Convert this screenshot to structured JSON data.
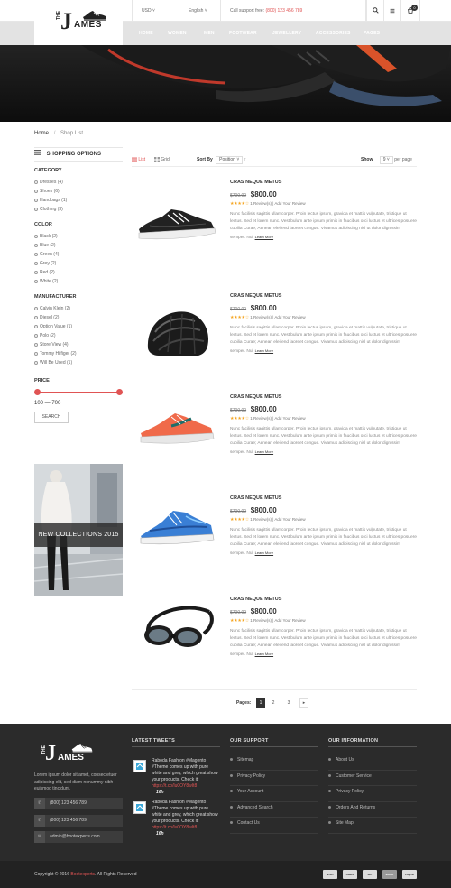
{
  "header": {
    "currency": "USD",
    "language": "English",
    "support_label": "Call support free:",
    "support_phone": "(800) 123 456 789",
    "cart_count": "0",
    "logo_the": "THE",
    "logo_j": "J",
    "logo_ames": "AMES",
    "nav": [
      "HOME",
      "WOMEN",
      "MEN",
      "FOOTWEAR",
      "JEWELLERY",
      "ACCESSORIES",
      "PAGES"
    ]
  },
  "breadcrumb": {
    "home": "Home",
    "separator": "/",
    "current": "Shop List"
  },
  "sidebar": {
    "title": "SHOPPING OPTIONS",
    "category_title": "CATEGORY",
    "categories": [
      "Dresses (4)",
      "Shoes (6)",
      "Handbags (1)",
      "Clothing (3)"
    ],
    "color_title": "COLOR",
    "colors": [
      "Black (2)",
      "Blue (2)",
      "Green (4)",
      "Grey (2)",
      "Red (2)",
      "White (2)"
    ],
    "manufacturer_title": "MANUFACTURER",
    "manufacturers": [
      "Calvin Klein (2)",
      "Diesel (2)",
      "Option Value (1)",
      "Polo (2)",
      "Store View (4)",
      "Tommy Hilfiger (2)",
      "Will Be Used (1)"
    ],
    "price_title": "PRICE",
    "price_range": "100 — 700",
    "search_label": "SEARCH",
    "promo_label": "NEW COLLECTIONS 2015"
  },
  "toolbar": {
    "list_label": "List",
    "grid_label": "Grid",
    "sort_label": "Sort By",
    "sort_value": "Position",
    "show_label": "Show",
    "show_value": "9",
    "per_page_label": "per page"
  },
  "products": [
    {
      "name": "CRAS NEQUE METUS",
      "old_price": "$700.00",
      "price": "$800.00",
      "stars": "★★★★☆",
      "reviews": "1 Review(s) | Add Your Review",
      "desc": "Nunc facilisis sagittis ullamcorper. Proin lectus ipsum, gravida et mattis vulputate, tristique ut lectus. Sed et lorem nunc. Vestibulum ante ipsum primis in faucibus orci luctus et ultrices posuere cubilia Curae; Aenean eleifend laoreet congue. Vivamus adipiscing nisl ut dolor dignissim semper. Nul",
      "learn": "Learn More"
    },
    {
      "name": "CRAS NEQUE METUS",
      "old_price": "$700.00",
      "price": "$800.00",
      "stars": "★★★★☆",
      "reviews": "1 Review(s) | Add Your Review",
      "desc": "Nunc facilisis sagittis ullamcorper. Proin lectus ipsum, gravida et mattis vulputate, tristique ut lectus. Sed et lorem nunc. Vestibulum ante ipsum primis in faucibus orci luctus et ultrices posuere cubilia Curae; Aenean eleifend laoreet congue. Vivamus adipiscing nisl ut dolor dignissim semper. Nul",
      "learn": "Learn More"
    },
    {
      "name": "CRAS NEQUE METUS",
      "old_price": "$700.00",
      "price": "$800.00",
      "stars": "★★★★☆",
      "reviews": "1 Review(s) | Add Your Review",
      "desc": "Nunc facilisis sagittis ullamcorper. Proin lectus ipsum, gravida et mattis vulputate, tristique ut lectus. Sed et lorem nunc. Vestibulum ante ipsum primis in faucibus orci luctus et ultrices posuere cubilia Curae; Aenean eleifend laoreet congue. Vivamus adipiscing nisl ut dolor dignissim semper. Nul",
      "learn": "Learn More"
    },
    {
      "name": "CRAS NEQUE METUS",
      "old_price": "$700.00",
      "price": "$800.00",
      "stars": "★★★★☆",
      "reviews": "1 Review(s) | Add Your Review",
      "desc": "Nunc facilisis sagittis ullamcorper. Proin lectus ipsum, gravida et mattis vulputate, tristique ut lectus. Sed et lorem nunc. Vestibulum ante ipsum primis in faucibus orci luctus et ultrices posuere cubilia Curae; Aenean eleifend laoreet congue. Vivamus adipiscing nisl ut dolor dignissim semper. Nul",
      "learn": "Learn More"
    },
    {
      "name": "CRAS NEQUE METUS",
      "old_price": "$700.00",
      "price": "$800.00",
      "stars": "★★★★☆",
      "reviews": "1 Review(s) | Add Your Review",
      "desc": "Nunc facilisis sagittis ullamcorper. Proin lectus ipsum, gravida et mattis vulputate, tristique ut lectus. Sed et lorem nunc. Vestibulum ante ipsum primis in faucibus orci luctus et ultrices posuere cubilia Curae; Aenean eleifend laoreet congue. Vivamus adipiscing nisl ut dolor dignissim semper. Nul",
      "learn": "Learn More"
    }
  ],
  "pagination": {
    "label": "Pages:",
    "pages": [
      "1",
      "2",
      "3"
    ],
    "next": "▸"
  },
  "footer": {
    "about": "Lorem ipsum dolor sit amet, consectetuer adipiscing elit, sed diam nonummy nibh euismod tincidunt.",
    "phone1": "(800) 123 456 789",
    "phone2": "(800) 123 456 789",
    "email": "admin@bootexperts.com",
    "tweets_title": "LATEST TWEETS",
    "tweets": [
      {
        "text": "Raboda Fashion #Magento #Theme comes up with pure white and grey, which great show your products. Check it:",
        "link": "https://t.co/lu0OY8wIt8",
        "time": "16h"
      },
      {
        "text": "Raboda Fashion #Magento #Theme comes up with pure white and grey, which great show your products. Check it:",
        "link": "https://t.co/lu0OY8wIt8",
        "time": "16h"
      }
    ],
    "support_title": "OUR SUPPORT",
    "support_links": [
      "Sitemap",
      "Privacy Policy",
      "Your Account",
      "Advanced Search",
      "Contact Us"
    ],
    "info_title": "OUR INFORMATION",
    "info_links": [
      "About Us",
      "Customer Service",
      "Privacy Policy",
      "Orders And Returns",
      "Site Map"
    ],
    "copyright_prefix": "Copyright © 2016",
    "copyright_brand": "Bootexperts",
    "copyright_suffix": ". All Rights Reserved",
    "payments": [
      "VISA",
      "AMEX",
      "MC",
      "BANK",
      "PayPal"
    ]
  },
  "colors": {
    "accent": "#e05454",
    "footer_bg": "#2b2b2b",
    "star": "#f5a623"
  }
}
